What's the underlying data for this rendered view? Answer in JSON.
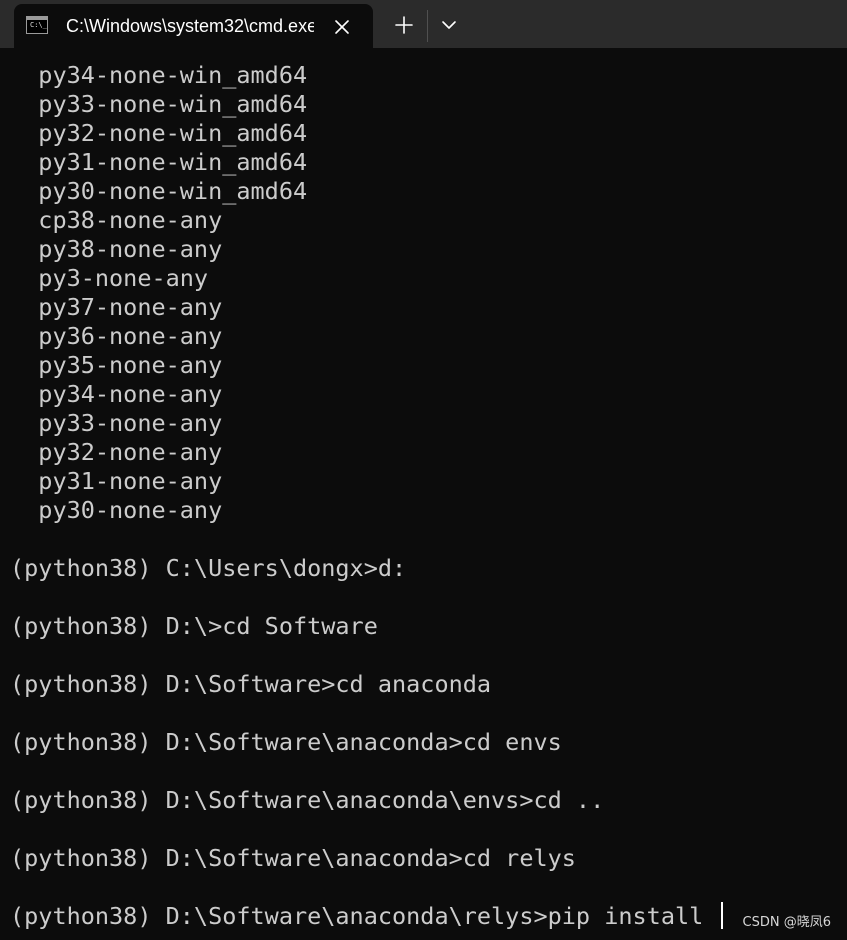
{
  "tab": {
    "title": "C:\\Windows\\system32\\cmd.exe",
    "icon": "cmd-icon",
    "icon_text": "C:\\_"
  },
  "toolbar": {
    "new_tab_icon": "plus-icon",
    "dropdown_icon": "chevron-down-icon"
  },
  "terminal": {
    "lines": [
      "  py34-none-win_amd64",
      "  py33-none-win_amd64",
      "  py32-none-win_amd64",
      "  py31-none-win_amd64",
      "  py30-none-win_amd64",
      "  cp38-none-any",
      "  py38-none-any",
      "  py3-none-any",
      "  py37-none-any",
      "  py36-none-any",
      "  py35-none-any",
      "  py34-none-any",
      "  py33-none-any",
      "  py32-none-any",
      "  py31-none-any",
      "  py30-none-any",
      "",
      "(python38) C:\\Users\\dongx>d:",
      "",
      "(python38) D:\\>cd Software",
      "",
      "(python38) D:\\Software>cd anaconda",
      "",
      "(python38) D:\\Software\\anaconda>cd envs",
      "",
      "(python38) D:\\Software\\anaconda\\envs>cd ..",
      "",
      "(python38) D:\\Software\\anaconda>cd relys",
      "",
      "(python38) D:\\Software\\anaconda\\relys>pip install "
    ],
    "text_color": "#cccccc",
    "background": "#0c0c0c"
  },
  "watermark": "CSDN @晓凤6"
}
